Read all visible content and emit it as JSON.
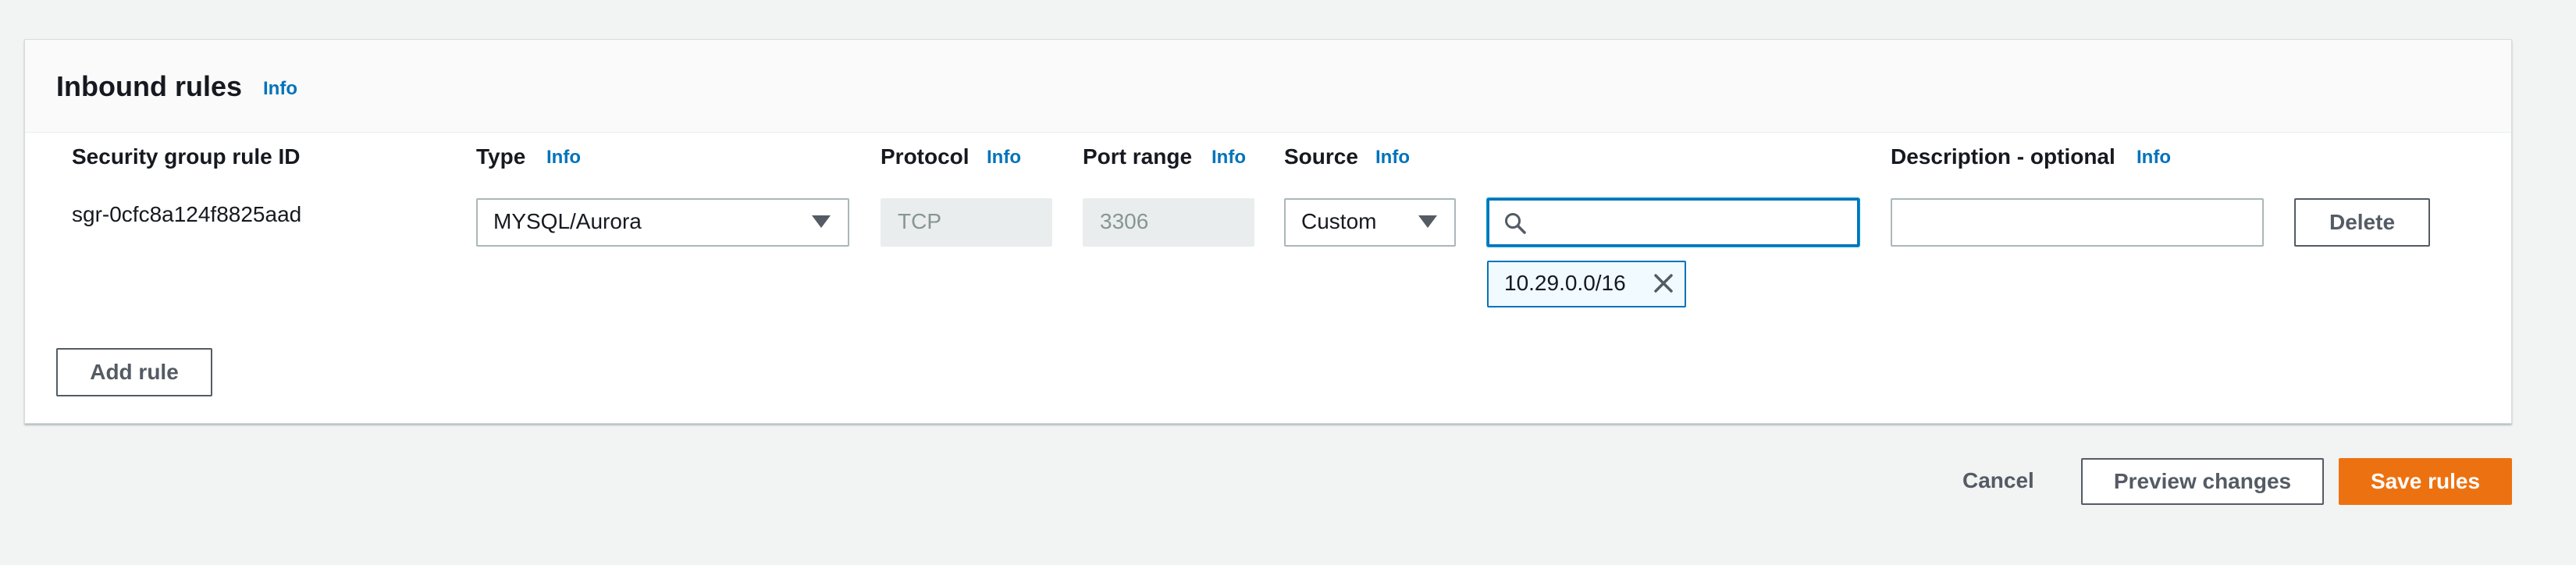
{
  "panel": {
    "title": "Inbound rules",
    "title_info": "Info"
  },
  "columns": {
    "rule_id": "Security group rule ID",
    "type": "Type",
    "type_info": "Info",
    "protocol": "Protocol",
    "protocol_info": "Info",
    "port_range": "Port range",
    "port_range_info": "Info",
    "source": "Source",
    "source_info": "Info",
    "description": "Description - optional",
    "description_info": "Info"
  },
  "rule": {
    "id": "sgr-0cfc8a124f8825aad",
    "type_value": "MYSQL/Aurora",
    "protocol_value": "TCP",
    "port_range_value": "3306",
    "source_value": "Custom",
    "search_value": "",
    "source_token": "10.29.0.0/16",
    "description_value": "",
    "delete_label": "Delete"
  },
  "add_rule_label": "Add rule",
  "footer": {
    "cancel_label": "Cancel",
    "preview_label": "Preview changes",
    "save_label": "Save rules"
  },
  "colors": {
    "accent": "#0073bb",
    "primary": "#ec7211"
  },
  "icons": [
    "caret-down-icon",
    "search-icon",
    "close-icon"
  ]
}
